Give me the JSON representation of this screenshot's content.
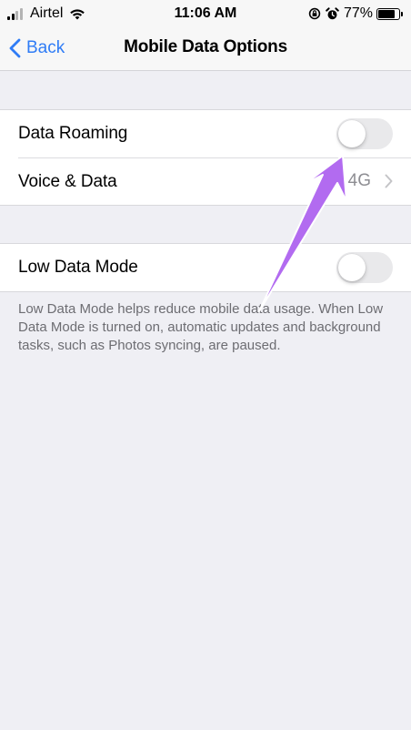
{
  "status_bar": {
    "carrier": "Airtel",
    "time": "11:06 AM",
    "battery_percent": "77%",
    "battery_level": 0.77,
    "icons": [
      "signal-icon",
      "wifi-icon",
      "orientation-lock-icon",
      "alarm-icon",
      "battery-icon"
    ]
  },
  "nav": {
    "back_label": "Back",
    "title": "Mobile Data Options"
  },
  "roaming_group": {
    "data_roaming": {
      "label": "Data Roaming",
      "enabled": false
    },
    "voice_data": {
      "label": "Voice & Data",
      "value": "4G"
    }
  },
  "low_data_group": {
    "low_data_mode": {
      "label": "Low Data Mode",
      "enabled": false
    },
    "footnote": "Low Data Mode helps reduce mobile data usage. When Low Data Mode is turned on, automatic updates and background tasks, such as Photos syncing, are paused."
  },
  "colors": {
    "accent": "#2f7cf6",
    "background": "#efeff4",
    "toggle_off": "#e9e9eb",
    "annotation_arrow": "#b26bf0"
  }
}
